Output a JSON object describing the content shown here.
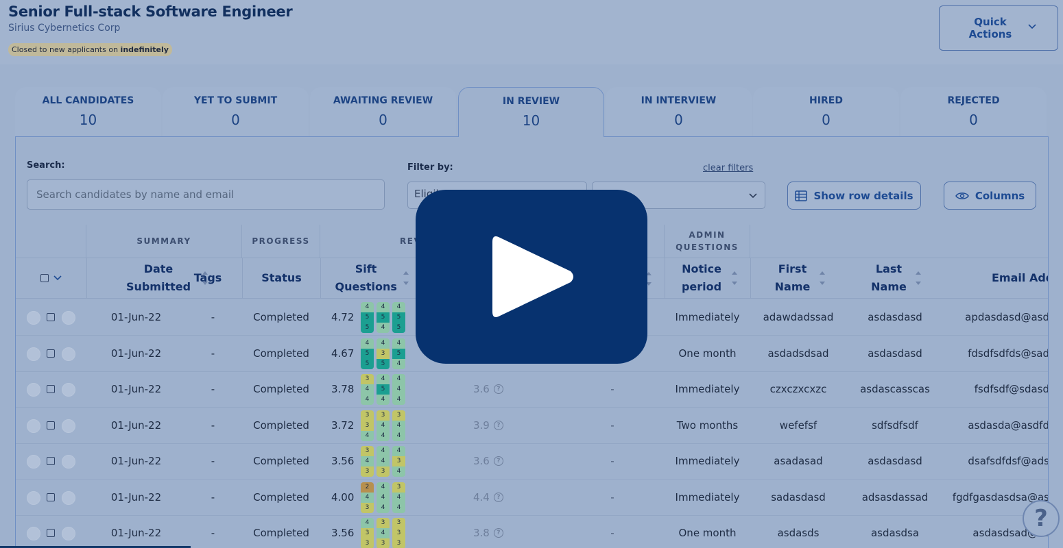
{
  "job": {
    "title": "Senior Full-stack Software Engineer",
    "company": "Sirius Cybernetics Corp",
    "status_prefix": "Closed to new applicants on",
    "status_value": "indefinitely"
  },
  "quick_actions": {
    "label": "Quick Actions"
  },
  "tabs": [
    {
      "label": "ALL CANDIDATES",
      "count": "10"
    },
    {
      "label": "YET TO SUBMIT",
      "count": "0"
    },
    {
      "label": "AWAITING REVIEW",
      "count": "0"
    },
    {
      "label": "IN REVIEW",
      "count": "10"
    },
    {
      "label": "IN INTERVIEW",
      "count": "0"
    },
    {
      "label": "HIRED",
      "count": "0"
    },
    {
      "label": "REJECTED",
      "count": "0"
    }
  ],
  "search": {
    "label": "Search:",
    "placeholder": "Search candidates by name and email"
  },
  "filter": {
    "label": "Filter by:",
    "value": "Eligib",
    "clear": "clear filters"
  },
  "buttons": {
    "row_details": "Show row details",
    "columns": "Columns"
  },
  "groups": {
    "summary": "SUMMARY",
    "progress": "PROGRESS",
    "review": "REV",
    "admin": "ADMIN QUESTIONS"
  },
  "columns": {
    "date": "Date Submitted",
    "tags": "Tags",
    "status": "Status",
    "sift": "Sift Questions",
    "notice": "Notice period",
    "first": "First Name",
    "last": "Last Name",
    "email": "Email Addr"
  },
  "colors": {
    "score_1": "#1f9e94",
    "score_2": "#b6904f",
    "score_3": "#c1c567",
    "score_4": "#8dc5a9",
    "score_5": "#1b9f91",
    "play_button": "#07326f"
  },
  "rows": [
    {
      "date": "01-Jun-22",
      "tags": "-",
      "status": "Completed",
      "score": "4.72",
      "pills": [
        [
          4,
          5,
          5
        ],
        [
          4,
          5,
          4
        ],
        [
          4,
          5,
          5
        ]
      ],
      "review": "",
      "extra": "",
      "notice": "Immediately",
      "first": "adawdadssad",
      "last": "asdasdasd",
      "email": "apdasdasd@asd"
    },
    {
      "date": "01-Jun-22",
      "tags": "-",
      "status": "Completed",
      "score": "4.67",
      "pills": [
        [
          4,
          5,
          5
        ],
        [
          4,
          3,
          5
        ],
        [
          4,
          5,
          4
        ]
      ],
      "review": "",
      "extra": "",
      "notice": "One month",
      "first": "asdadsdsad",
      "last": "asdasdasd",
      "email": "fdsdfsdfds@sad"
    },
    {
      "date": "01-Jun-22",
      "tags": "-",
      "status": "Completed",
      "score": "3.78",
      "pills": [
        [
          3,
          4,
          4
        ],
        [
          4,
          5,
          4
        ],
        [
          4,
          4,
          4
        ]
      ],
      "review": "3.6",
      "extra": "-",
      "notice": "Immediately",
      "first": "czxczxcxzc",
      "last": "asdascasscas",
      "email": "fsdfsdf@sdasd"
    },
    {
      "date": "01-Jun-22",
      "tags": "-",
      "status": "Completed",
      "score": "3.72",
      "pills": [
        [
          3,
          3,
          4
        ],
        [
          3,
          4,
          4
        ],
        [
          3,
          4,
          4
        ]
      ],
      "review": "3.9",
      "extra": "-",
      "notice": "Two months",
      "first": "wefefsf",
      "last": "sdfsdfsdf",
      "email": "asdasda@asdfd"
    },
    {
      "date": "01-Jun-22",
      "tags": "-",
      "status": "Completed",
      "score": "3.56",
      "pills": [
        [
          3,
          4,
          3
        ],
        [
          4,
          4,
          3
        ],
        [
          4,
          3,
          4
        ]
      ],
      "review": "3.6",
      "extra": "-",
      "notice": "Immediately",
      "first": "asadasad",
      "last": "asdasdasd",
      "email": "dsafsdfdsf@ads"
    },
    {
      "date": "01-Jun-22",
      "tags": "-",
      "status": "Completed",
      "score": "4.00",
      "pills": [
        [
          2,
          4,
          3
        ],
        [
          4,
          4,
          4
        ],
        [
          3,
          4,
          4
        ]
      ],
      "review": "4.4",
      "extra": "-",
      "notice": "Immediately",
      "first": "sadasdasd",
      "last": "adsasdassad",
      "email": "fgdfgasdasdsa@as"
    },
    {
      "date": "01-Jun-22",
      "tags": "-",
      "status": "Completed",
      "score": "3.56",
      "pills": [
        [
          4,
          3,
          3
        ],
        [
          3,
          4,
          3
        ],
        [
          3,
          3,
          3
        ]
      ],
      "review": "3.8",
      "extra": "-",
      "notice": "One month",
      "first": "asdasds",
      "last": "asdasdsa",
      "email": "asdasdsad@as"
    }
  ]
}
